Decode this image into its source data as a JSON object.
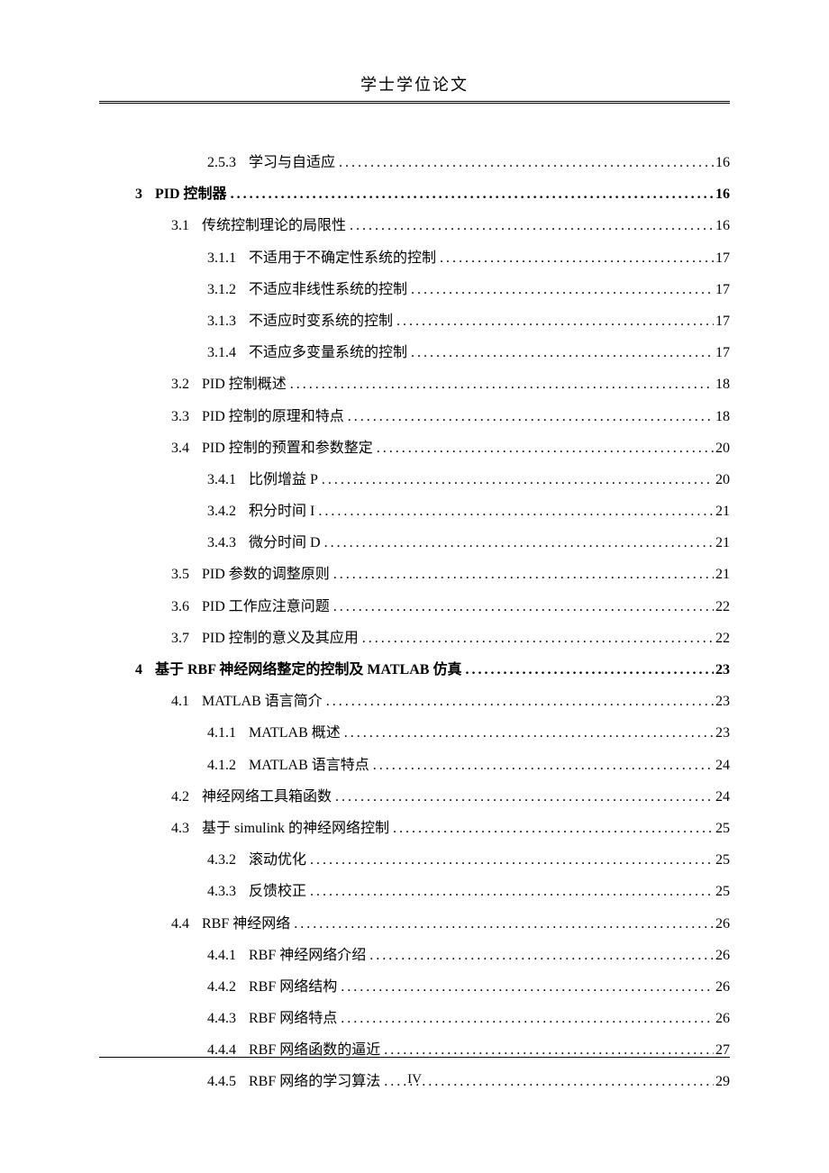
{
  "header": {
    "title": "学士学位论文"
  },
  "footer": {
    "page": "IV"
  },
  "toc": [
    {
      "level": 2,
      "num": "2.5.3",
      "label": "学习与自适应",
      "page": "16",
      "bold": false
    },
    {
      "level": 0,
      "num": "3",
      "label": "PID 控制器",
      "page": "16",
      "bold": true
    },
    {
      "level": 1,
      "num": "3.1",
      "label": "传统控制理论的局限性",
      "page": "16",
      "bold": false
    },
    {
      "level": 2,
      "num": "3.1.1",
      "label": "不适用于不确定性系统的控制",
      "page": "17",
      "bold": false
    },
    {
      "level": 2,
      "num": "3.1.2",
      "label": "不适应非线性系统的控制",
      "page": "17",
      "bold": false
    },
    {
      "level": 2,
      "num": "3.1.3",
      "label": "不适应时变系统的控制",
      "page": "17",
      "bold": false
    },
    {
      "level": 2,
      "num": "3.1.4",
      "label": "不适应多变量系统的控制",
      "page": "17",
      "bold": false
    },
    {
      "level": 1,
      "num": "3.2",
      "label": "PID 控制概述",
      "page": "18",
      "bold": false
    },
    {
      "level": 1,
      "num": "3.3",
      "label": "PID 控制的原理和特点",
      "page": "18",
      "bold": false
    },
    {
      "level": 1,
      "num": "3.4",
      "label": "PID 控制的预置和参数整定",
      "page": "20",
      "bold": false
    },
    {
      "level": 2,
      "num": "3.4.1",
      "label": "比例增益 P",
      "page": "20",
      "bold": false
    },
    {
      "level": 2,
      "num": "3.4.2",
      "label": "积分时间 I",
      "page": "21",
      "bold": false
    },
    {
      "level": 2,
      "num": "3.4.3",
      "label": "微分时间 D",
      "page": "21",
      "bold": false
    },
    {
      "level": 1,
      "num": "3.5",
      "label": "PID 参数的调整原则",
      "page": "21",
      "bold": false
    },
    {
      "level": 1,
      "num": "3.6",
      "label": "PID 工作应注意问题",
      "page": "22",
      "bold": false
    },
    {
      "level": 1,
      "num": "3.7",
      "label": "PID 控制的意义及其应用",
      "page": "22",
      "bold": false
    },
    {
      "level": 0,
      "num": "4",
      "label": "基于 RBF 神经网络整定的控制及 MATLAB 仿真",
      "page": "23",
      "bold": true
    },
    {
      "level": 1,
      "num": "4.1",
      "label": "MATLAB 语言简介",
      "page": "23",
      "bold": false
    },
    {
      "level": 2,
      "num": "4.1.1",
      "label": "MATLAB 概述",
      "page": "23",
      "bold": false
    },
    {
      "level": 2,
      "num": "4.1.2",
      "label": "MATLAB 语言特点",
      "page": "24",
      "bold": false
    },
    {
      "level": 1,
      "num": "4.2",
      "label": "神经网络工具箱函数",
      "page": "24",
      "bold": false
    },
    {
      "level": 1,
      "num": "4.3",
      "label": "基于 simulink 的神经网络控制",
      "page": "25",
      "bold": false
    },
    {
      "level": 2,
      "num": "4.3.2",
      "label": "滚动优化",
      "page": "25",
      "bold": false
    },
    {
      "level": 2,
      "num": "4.3.3",
      "label": "反馈校正",
      "page": "25",
      "bold": false
    },
    {
      "level": 1,
      "num": "4.4",
      "label": "RBF 神经网络",
      "page": "26",
      "bold": false
    },
    {
      "level": 2,
      "num": "4.4.1",
      "label": "RBF 神经网络介绍",
      "page": "26",
      "bold": false
    },
    {
      "level": 2,
      "num": "4.4.2",
      "label": "RBF 网络结构",
      "page": "26",
      "bold": false
    },
    {
      "level": 2,
      "num": "4.4.3",
      "label": "RBF 网络特点",
      "page": "26",
      "bold": false
    },
    {
      "level": 2,
      "num": "4.4.4",
      "label": "RBF 网络函数的逼近",
      "page": "27",
      "bold": false
    },
    {
      "level": 2,
      "num": "4.4.5",
      "label": "RBF 网络的学习算法",
      "page": "29",
      "bold": false
    }
  ]
}
